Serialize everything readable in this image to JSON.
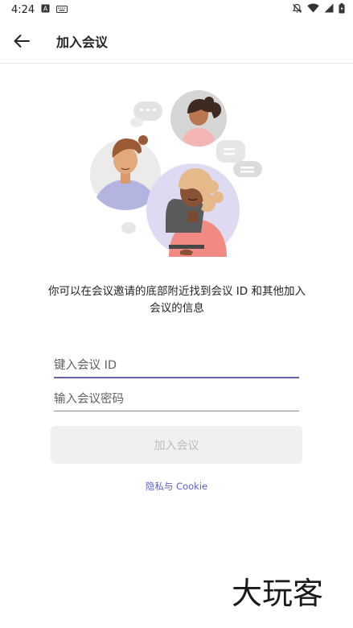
{
  "status_bar": {
    "time": "4:24",
    "icons": [
      "notification-a-icon",
      "keyboard-icon",
      "mute-bell-icon",
      "wifi-icon",
      "signal-icon",
      "battery-icon"
    ]
  },
  "app_bar": {
    "back_icon": "arrow-left-icon",
    "title": "加入会议"
  },
  "description": "你可以在会议邀请的底部附近找到会议 ID 和其他加入会议的信息",
  "form": {
    "meeting_id_placeholder": "键入会议 ID",
    "meeting_id_value": "",
    "password_placeholder": "输入会议密码",
    "password_value": ""
  },
  "join_button_label": "加入会议",
  "privacy_link": "隐私与 Cookie",
  "watermark_text": "大玩客",
  "colors": {
    "accent": "#6264a7",
    "link": "#5b5fc7",
    "disabled_button_bg": "#f0f0f0",
    "disabled_button_text": "#bdbdbd"
  }
}
